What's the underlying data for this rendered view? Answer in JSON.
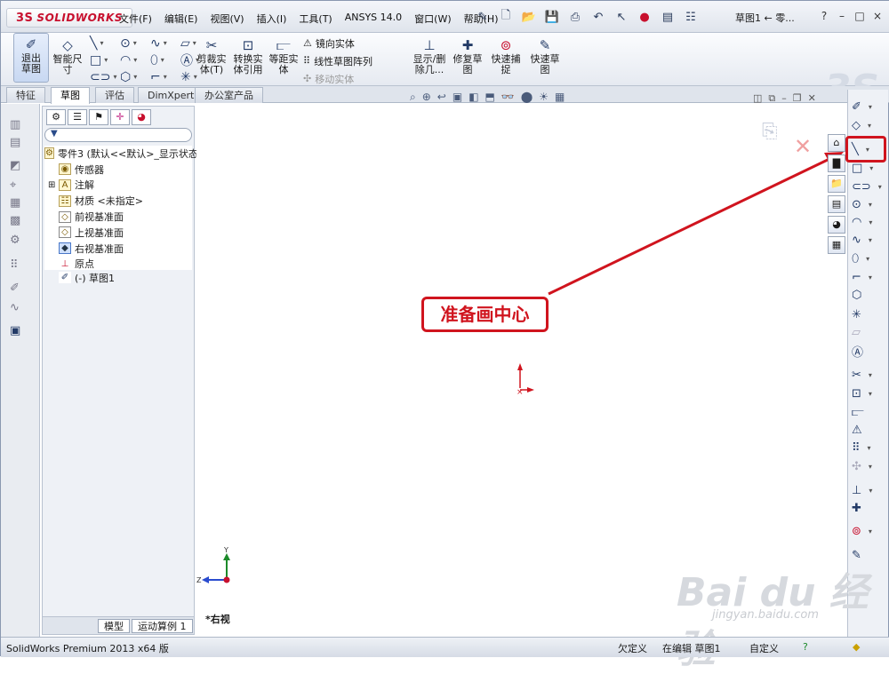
{
  "app": {
    "logo_text": "SOLIDWORKS",
    "logo_mark": "3S"
  },
  "menu": [
    "文件(F)",
    "编辑(E)",
    "视图(V)",
    "插入(I)",
    "工具(T)",
    "ANSYS 14.0",
    "窗口(W)",
    "帮助(H)"
  ],
  "document_title": "草图1 ← 零...",
  "window_controls": {
    "help": "?",
    "minimize": "–",
    "restore": "□",
    "close": "×"
  },
  "ribbon": {
    "exit_sketch": "退出草图",
    "smart_dimension": "智能尺寸",
    "trim_entities": "剪裁实体(T)",
    "convert_entities": "转换实体引用",
    "offset_entities": "等距实体",
    "mirror_entities": "镜向实体",
    "linear_pattern": "线性草图阵列",
    "move_entities": "移动实体",
    "display_delete_relations": "显示/删除几...",
    "repair_sketch": "修复草图",
    "quick_snaps": "快速捕捉",
    "rapid_sketch": "快速草图"
  },
  "tabs": [
    "特征",
    "草图",
    "评估",
    "DimXpert",
    "办公室产品"
  ],
  "active_tab": "草图",
  "feature_tree": {
    "root": "零件3 (默认<<默认>_显示状态",
    "items": [
      "传感器",
      "注解",
      "材质 <未指定>",
      "前视基准面",
      "上视基准面",
      "右视基准面",
      "原点",
      "(-) 草图1"
    ]
  },
  "bottom_tabs": [
    "模型",
    "运动算例 1"
  ],
  "canvas": {
    "view_name": "*右视",
    "axis_y": "Y",
    "axis_z": "Z"
  },
  "annotation": {
    "callout_text": "准备画中心"
  },
  "status_bar": {
    "product": "SolidWorks Premium 2013 x64 版",
    "state": "欠定义",
    "editing": "在编辑 草图1",
    "units": "自定义"
  },
  "watermark": {
    "brand": "Bai du 经验",
    "url": "jingyan.baidu.com"
  },
  "colors": {
    "accent_red": "#d0141e",
    "brand_red": "#c8102e",
    "toolbar_blue": "#223a66"
  }
}
